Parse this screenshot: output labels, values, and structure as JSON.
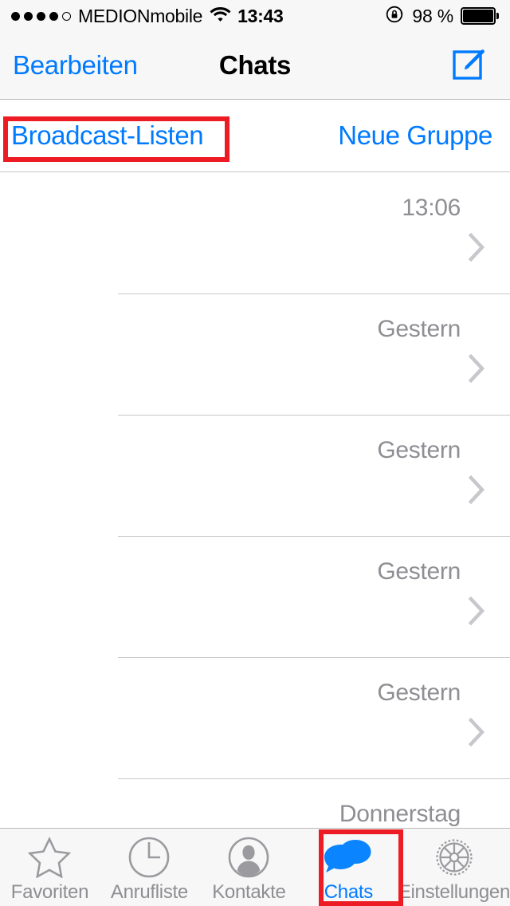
{
  "status_bar": {
    "signal_dots_filled": 4,
    "signal_dots_total": 5,
    "carrier": "MEDIONmobile",
    "wifi_icon": "wifi-icon",
    "time": "13:43",
    "rotation_lock_icon": "rotation-lock-icon",
    "battery_percent": "98 %",
    "battery_icon": "battery-full-icon"
  },
  "nav_bar": {
    "left_button": "Bearbeiten",
    "title": "Chats",
    "right_icon": "compose-icon"
  },
  "action_row": {
    "broadcast_lists": "Broadcast-Listen",
    "new_group": "Neue Gruppe"
  },
  "chat_list": {
    "rows": [
      {
        "timestamp": "13:06",
        "chevron": "chevron-right-icon"
      },
      {
        "timestamp": "Gestern",
        "chevron": "chevron-right-icon"
      },
      {
        "timestamp": "Gestern",
        "chevron": "chevron-right-icon"
      },
      {
        "timestamp": "Gestern",
        "chevron": "chevron-right-icon"
      },
      {
        "timestamp": "Gestern",
        "chevron": "chevron-right-icon"
      },
      {
        "timestamp": "Donnerstag",
        "chevron": "chevron-right-icon"
      }
    ]
  },
  "tab_bar": {
    "tabs": [
      {
        "label": "Favoriten",
        "icon": "star-icon",
        "active": false
      },
      {
        "label": "Anrufliste",
        "icon": "clock-icon",
        "active": false
      },
      {
        "label": "Kontakte",
        "icon": "person-icon",
        "active": false
      },
      {
        "label": "Chats",
        "icon": "chat-bubbles-icon",
        "active": true
      },
      {
        "label": "Einstellungen",
        "icon": "gear-icon",
        "active": false
      }
    ]
  },
  "annotations": {
    "highlight_color": "#ed1c24",
    "boxes": [
      "Broadcast-Listen",
      "Chats"
    ]
  },
  "colors": {
    "accent_blue": "#007aff",
    "bar_background": "#f7f7f7",
    "secondary_text": "#8e8e93",
    "separator": "#c8c7cc",
    "highlight_red": "#ed1c24"
  }
}
